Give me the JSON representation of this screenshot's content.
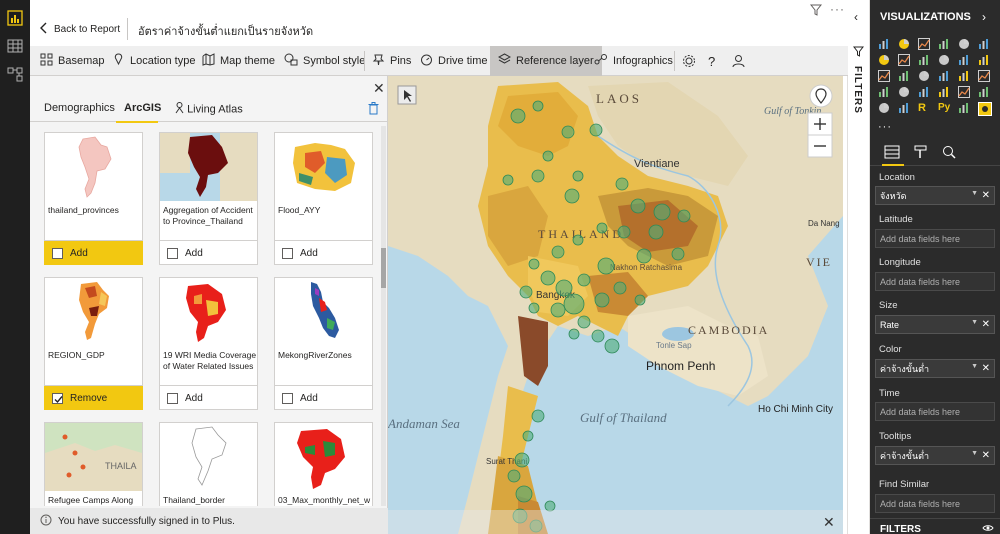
{
  "top": {
    "back_label": "Back to Report",
    "report_title": "อัตราค่าจ้างขั้นต่ำแยกเป็นรายจังหวัด"
  },
  "toolbar": {
    "items": [
      {
        "label": "Basemap",
        "icon": "basemap-grid-icon"
      },
      {
        "label": "Location type",
        "icon": "location-pin-icon"
      },
      {
        "label": "Map theme",
        "icon": "map-theme-icon"
      },
      {
        "label": "Symbol style",
        "icon": "symbol-style-icon"
      },
      {
        "label": "Pins",
        "icon": "pin-icon"
      },
      {
        "label": "Drive time",
        "icon": "drive-time-icon"
      },
      {
        "label": "Reference layer",
        "icon": "reference-layer-icon",
        "active": true
      },
      {
        "label": "Infographics",
        "icon": "infographics-icon"
      }
    ],
    "extra_icons": [
      "gear-icon",
      "help-icon",
      "user-icon"
    ]
  },
  "panel": {
    "tabs": [
      "Demographics",
      "ArcGIS",
      "Living Atlas"
    ],
    "active_tab": "ArcGIS",
    "cards": [
      {
        "name": "thailand_provinces",
        "action": "Add",
        "selected": true
      },
      {
        "name": "Aggregation of Accident to Province_Thailand",
        "action": "Add",
        "selected": false
      },
      {
        "name": "Flood_AYY",
        "action": "Add",
        "selected": false
      },
      {
        "name": "REGION_GDP",
        "action": "Remove",
        "selected": true
      },
      {
        "name": "19 WRI Media Coverage of Water Related Issues",
        "action": "Add",
        "selected": false
      },
      {
        "name": "MekongRiverZones",
        "action": "Add",
        "selected": false
      },
      {
        "name": "Refugee Camps Along",
        "action": "",
        "selected": false
      },
      {
        "name": "Thailand_border",
        "action": "",
        "selected": false
      },
      {
        "name": "03_Max_monthly_net_w",
        "action": "",
        "selected": false
      }
    ],
    "toast": "You have successfully signed in to Plus."
  },
  "map": {
    "labels": [
      {
        "text": "LAOS"
      },
      {
        "text": "Vientiane"
      },
      {
        "text": "THAILAND"
      },
      {
        "text": "Nakhon Ratchasima"
      },
      {
        "text": "Bangkok"
      },
      {
        "text": "CAMBODIA"
      },
      {
        "text": "Tonle Sap"
      },
      {
        "text": "Phnom Penh"
      },
      {
        "text": "Gulf of Thailand"
      },
      {
        "text": "Ho Chi Minh City"
      },
      {
        "text": "Gulf of Tonkin"
      },
      {
        "text": "Da Nang"
      },
      {
        "text": "Andaman Sea"
      },
      {
        "text": "Surat Thani"
      },
      {
        "text": "VIE"
      }
    ]
  },
  "filters_strip": {
    "label": "FILTERS"
  },
  "viz": {
    "title": "VISUALIZATIONS",
    "wells": [
      {
        "label": "Location",
        "value": "จังหวัด",
        "filled": true
      },
      {
        "label": "Latitude",
        "value": "Add data fields here",
        "filled": false
      },
      {
        "label": "Longitude",
        "value": "Add data fields here",
        "filled": false
      },
      {
        "label": "Size",
        "value": "Rate",
        "filled": true
      },
      {
        "label": "Color",
        "value": "ค่าจ้างขั้นต่ำ",
        "filled": true
      },
      {
        "label": "Time",
        "value": "Add data fields here",
        "filled": false
      },
      {
        "label": "Tooltips",
        "value": "ค่าจ้างขั้นต่ำ",
        "filled": true
      },
      {
        "label": "Find Similar",
        "value": "Add data fields here",
        "filled": false
      }
    ],
    "filters_label": "FILTERS"
  },
  "colors": {
    "accent": "#f2c811",
    "viz_bg": "#2b2b2b",
    "rail_bg": "#1f1f1f",
    "sea": "#b8d8e8",
    "land": "#e6dcc0",
    "circle": "#4fae7a"
  }
}
